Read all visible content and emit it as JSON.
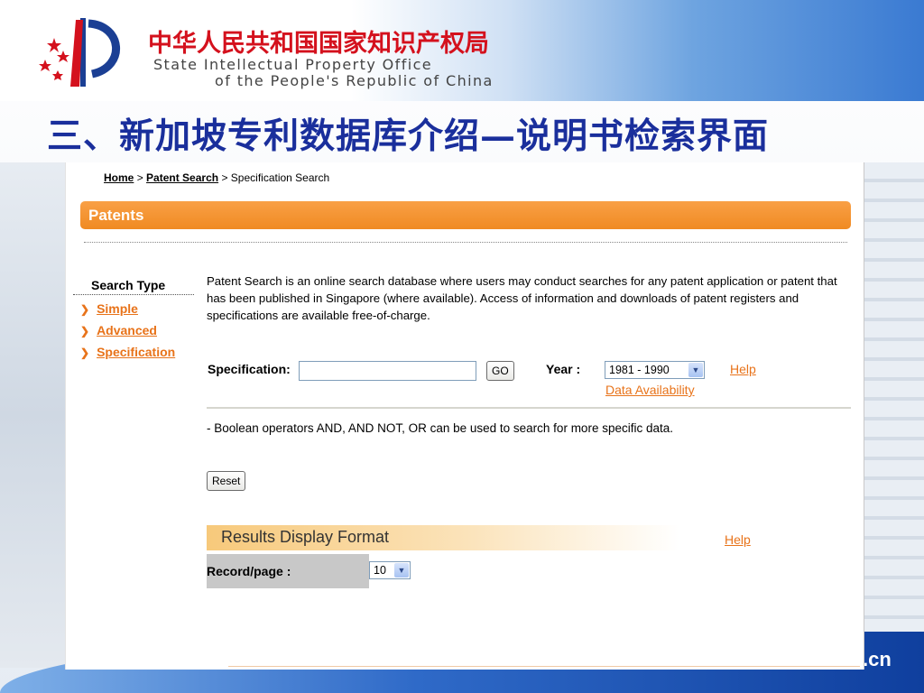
{
  "header": {
    "org_cn": "中华人民共和国国家知识产权局",
    "org_en_line1": "State Intellectual Property Office",
    "org_en_line2": "of the People's Republic of China",
    "slide_title": "三、新加坡专利数据库介绍—说明书检索界面",
    "logo_icon": "sipo-logo-icon"
  },
  "footer": {
    "domain_suffix": ".cn"
  },
  "page": {
    "breadcrumb": {
      "home": "Home",
      "sep1": ">",
      "patent_search": "Patent Search",
      "sep2": ">",
      "current": "Specification Search"
    },
    "section_title": "Patents",
    "sidebar": {
      "title": "Search Type",
      "items": [
        {
          "label": "Simple"
        },
        {
          "label": "Advanced"
        },
        {
          "label": "Specification"
        }
      ]
    },
    "intro": "Patent Search is an online search database where users may conduct searches for any patent application or patent that has been published in Singapore (where available). Access of information and downloads of patent registers and specifications are available free-of-charge.",
    "search": {
      "spec_label": "Specification:",
      "spec_value": "",
      "go_label": "GO",
      "year_label": "Year :",
      "year_selected": "1981 - 1990",
      "help_label": "Help",
      "data_availability_label": "Data Availability"
    },
    "boolean_note": "- Boolean operators AND, AND NOT, OR  can be used to search for more specific data.",
    "reset_label": "Reset",
    "results": {
      "title": "Results Display Format",
      "help_label": "Help",
      "record_label": "Record/page :",
      "record_selected": "10"
    }
  },
  "colors": {
    "title_blue": "#1a2f9c",
    "org_red": "#d4111d",
    "patents_orange": "#f08a22",
    "link_orange": "#e8731a"
  }
}
